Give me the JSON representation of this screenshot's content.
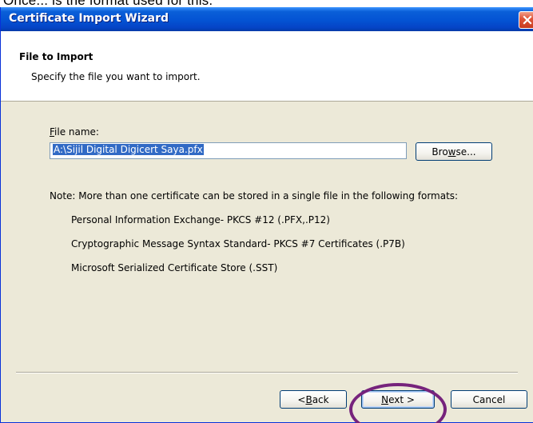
{
  "window": {
    "title": "Certificate Import Wizard",
    "top_caption": "Once... is the format used for this."
  },
  "header": {
    "title": "File to Import",
    "subtitle": "Specify the file you want to import."
  },
  "form": {
    "file_label_accel": "F",
    "file_label_rest": "ile name:",
    "file_value": "A:\\Sijil Digital Digicert Saya.pfx",
    "browse_accel": "w",
    "browse_pre": "Bro",
    "browse_post": "se..."
  },
  "note": {
    "text": "Note:  More than one certificate can be stored in a single file in the following formats:",
    "formats": [
      "Personal Information Exchange- PKCS #12 (.PFX,.P12)",
      "Cryptographic Message Syntax Standard- PKCS #7 Certificates (.P7B)",
      "Microsoft Serialized Certificate Store (.SST)"
    ]
  },
  "buttons": {
    "back_pre": "< ",
    "back_accel": "B",
    "back_rest": "ack",
    "next_accel": "N",
    "next_rest": "ext >",
    "cancel": "Cancel"
  },
  "colors": {
    "title_bar": "#0453d3",
    "highlight_ring": "#76237c",
    "selection": "#316ac5"
  },
  "icons": {
    "close": "close-icon"
  }
}
